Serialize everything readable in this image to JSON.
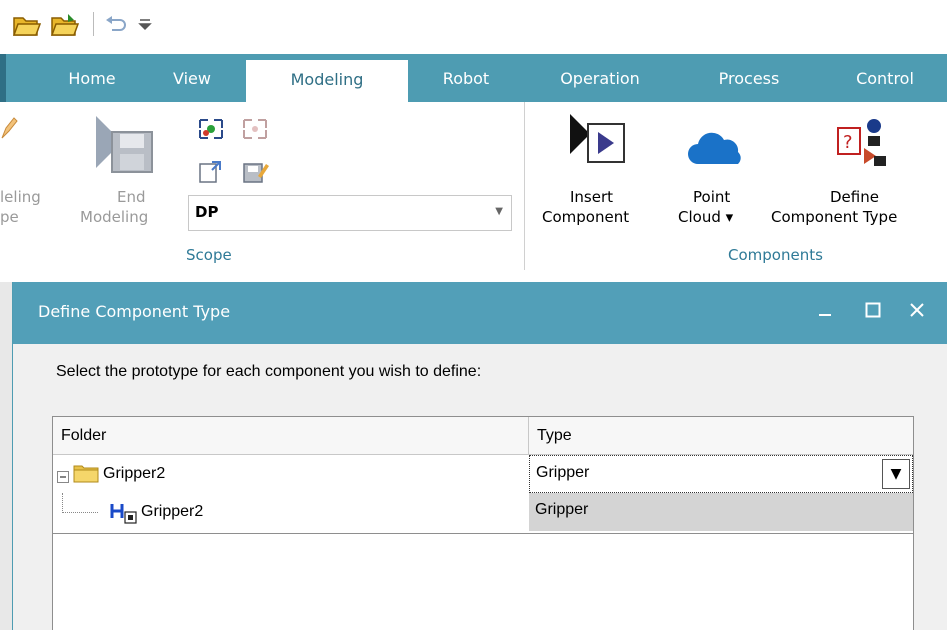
{
  "quick_access": {
    "icons": [
      "open-folder-icon",
      "open-folder-icon",
      "undo-icon",
      "customize-dropdown-icon"
    ]
  },
  "tabs": [
    "Home",
    "View",
    "Modeling",
    "Robot",
    "Operation",
    "Process",
    "Control"
  ],
  "ribbon": {
    "modeling_scope_label_1": "leling",
    "modeling_scope_label_2": "pe",
    "end_modeling_line1": "End",
    "end_modeling_line2": "Modeling",
    "scope_combo_value": "DP",
    "scope_group_label": "Scope",
    "insert_component_line1": "Insert",
    "insert_component_line2": "Component",
    "point_cloud_line1": "Point",
    "point_cloud_line2": "Cloud ▾",
    "define_type_line1": "Define",
    "define_type_line2": "Component Type",
    "components_group_label": "Components"
  },
  "dialog": {
    "title": "Define Component Type",
    "prompt": "Select the prototype for each component you wish to define:",
    "columns": [
      "Folder",
      "Type"
    ],
    "rows": [
      {
        "name": "Gripper2",
        "type": "Gripper",
        "icon": "folder-icon"
      },
      {
        "name": "Gripper2",
        "type": "Gripper",
        "icon": "gripper-component-icon"
      }
    ]
  },
  "colors": {
    "accent": "#4e9cb2",
    "title_bar": "#529fb8",
    "group_label": "#2f7a97"
  }
}
